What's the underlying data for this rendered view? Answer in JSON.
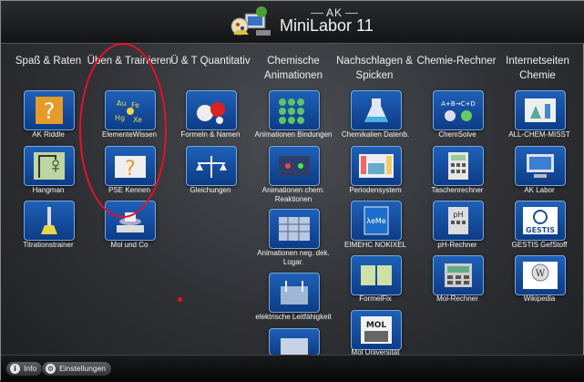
{
  "header": {
    "sub": "AK",
    "title": "MiniLabor 11"
  },
  "columns": [
    {
      "heading": "Spaß & Raten",
      "items": [
        "AK Riddle",
        "Hangman",
        "Titrationstrainer"
      ]
    },
    {
      "heading": "Üben & Trainieren",
      "items": [
        "ElementeWissen",
        "PSE Kennen",
        "Mol und Co"
      ]
    },
    {
      "heading": "Ü & T Quantitativ",
      "items": [
        "Formeln & Namen",
        "Gleichungen"
      ]
    },
    {
      "heading": "Chemische Animationen",
      "items": [
        "Animationen Bindungen",
        "Animationen chem. Reaktionen",
        "Animationen neg. dek. Logar.",
        "elektrische Leitfähigkeit"
      ]
    },
    {
      "heading": "Nachschlagen & Spicken",
      "items": [
        "Chemikalien Datenb.",
        "Periodensystem",
        "EIMEHC NOKIXEL",
        "FormelFix",
        "Mol Universität"
      ]
    },
    {
      "heading": "Chemie-Rechner",
      "items": [
        "ChemSolve",
        "Taschenrechner",
        "pH-Rechner",
        "Mol-Rechner"
      ]
    },
    {
      "heading": "Internetseiten Chemie",
      "items": [
        "ALL-CHEM-MISST",
        "AK Labor",
        "GESTIS GefStoff",
        "Wikipedia"
      ]
    }
  ],
  "footer": {
    "info_label": "Info",
    "settings_label": "Einstellungen"
  },
  "colors": {
    "tile_blue": "#1e60b8",
    "annotation_red": "#e8102b"
  }
}
